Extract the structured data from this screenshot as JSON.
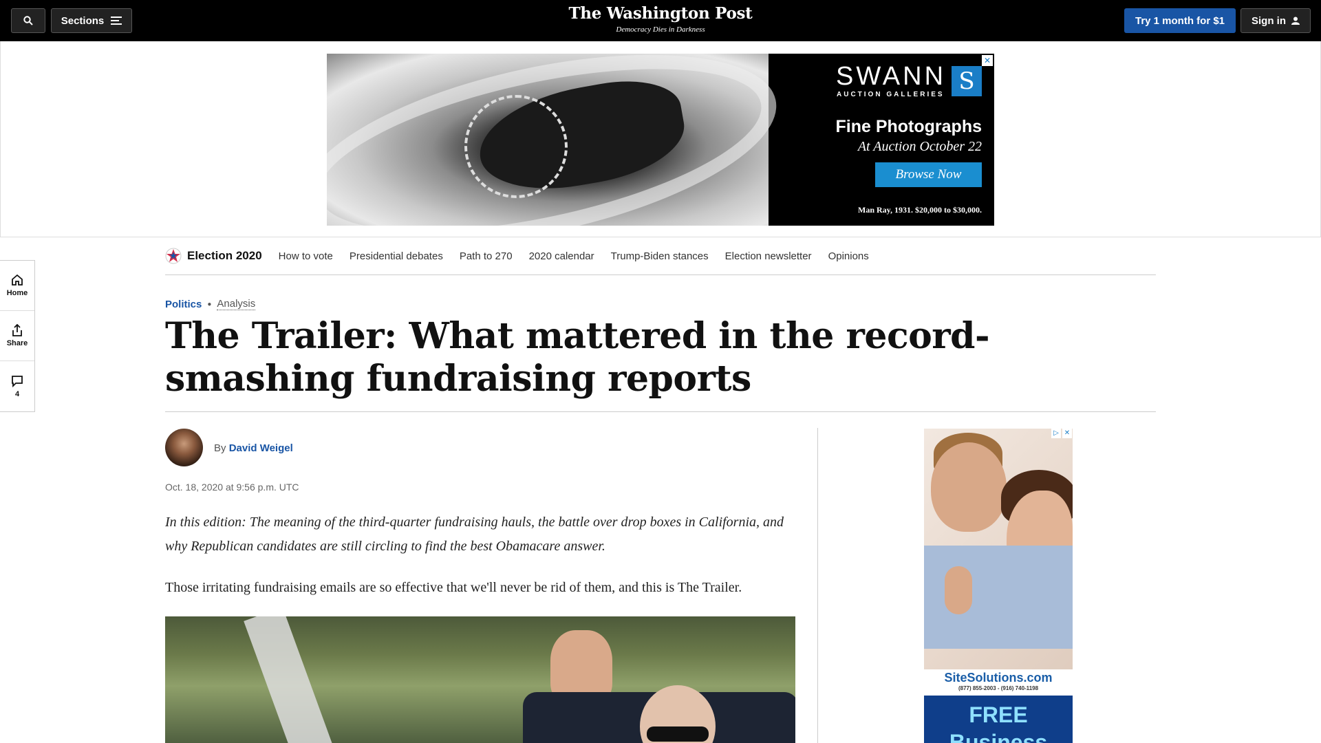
{
  "topbar": {
    "sections_label": "Sections",
    "logo": "The Washington Post",
    "tagline": "Democracy Dies in Darkness",
    "subscribe_label": "Try 1 month for $1",
    "signin_label": "Sign in"
  },
  "top_ad": {
    "brand": "SWANN",
    "brand_sub": "AUCTION GALLERIES",
    "logo_letter": "S",
    "headline": "Fine Photographs",
    "subhead": "At Auction October 22",
    "cta": "Browse Now",
    "caption": "Man Ray, 1931. $20,000 to $30,000.",
    "close": "✕"
  },
  "election_nav": {
    "title": "Election 2020",
    "links": [
      "How to vote",
      "Presidential debates",
      "Path to 270",
      "2020 calendar",
      "Trump-Biden stances",
      "Election newsletter",
      "Opinions"
    ]
  },
  "rail": {
    "home_label": "Home",
    "share_label": "Share",
    "comments_count": "4"
  },
  "article": {
    "category": "Politics",
    "label": "Analysis",
    "headline": "The Trailer: What mattered in the record-smashing fundraising reports",
    "byline_prefix": "By",
    "author": "David Weigel",
    "timestamp": "Oct. 18, 2020 at 9:56 p.m. UTC",
    "dek": "In this edition: The meaning of the third-quarter fundraising hauls, the battle over drop boxes in California, and why Republican candidates are still circling to find the best Obamacare answer.",
    "first_paragraph": "Those irritating fundraising emails are so effective that we'll never be rid of them, and this is The Trailer."
  },
  "side_ad": {
    "brand": "SiteSolutions.com",
    "phone": "(877) 855-2003 - (916) 740-1198",
    "promo": "FREE Business",
    "close_icons": [
      "▷",
      "✕"
    ]
  },
  "colors": {
    "accent_blue": "#1955a5",
    "topbar_bg": "#000000"
  }
}
